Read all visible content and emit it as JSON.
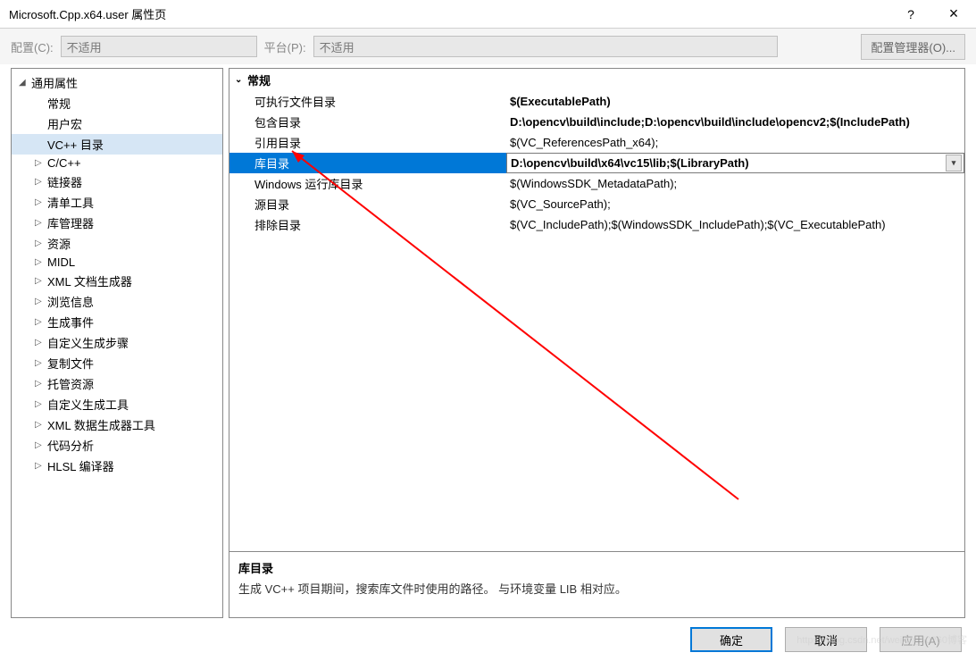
{
  "window": {
    "title": "Microsoft.Cpp.x64.user 属性页",
    "help": "?",
    "close": "×"
  },
  "toolbar": {
    "config_label": "配置(C):",
    "config_value": "不适用",
    "platform_label": "平台(P):",
    "platform_value": "不适用",
    "config_mgr": "配置管理器(O)..."
  },
  "tree": {
    "root": "通用属性",
    "items": [
      {
        "label": "常规",
        "level": 1,
        "expand": ""
      },
      {
        "label": "用户宏",
        "level": 1,
        "expand": ""
      },
      {
        "label": "VC++ 目录",
        "level": 1,
        "expand": "",
        "selected": true
      },
      {
        "label": "C/C++",
        "level": 1,
        "expand": "▷"
      },
      {
        "label": "链接器",
        "level": 1,
        "expand": "▷"
      },
      {
        "label": "清单工具",
        "level": 1,
        "expand": "▷"
      },
      {
        "label": "库管理器",
        "level": 1,
        "expand": "▷"
      },
      {
        "label": "资源",
        "level": 1,
        "expand": "▷"
      },
      {
        "label": "MIDL",
        "level": 1,
        "expand": "▷"
      },
      {
        "label": "XML 文档生成器",
        "level": 1,
        "expand": "▷"
      },
      {
        "label": "浏览信息",
        "level": 1,
        "expand": "▷"
      },
      {
        "label": "生成事件",
        "level": 1,
        "expand": "▷"
      },
      {
        "label": "自定义生成步骤",
        "level": 1,
        "expand": "▷"
      },
      {
        "label": "复制文件",
        "level": 1,
        "expand": "▷"
      },
      {
        "label": "托管资源",
        "level": 1,
        "expand": "▷"
      },
      {
        "label": "自定义生成工具",
        "level": 1,
        "expand": "▷"
      },
      {
        "label": "XML 数据生成器工具",
        "level": 1,
        "expand": "▷"
      },
      {
        "label": "代码分析",
        "level": 1,
        "expand": "▷"
      },
      {
        "label": "HLSL 编译器",
        "level": 1,
        "expand": "▷"
      }
    ]
  },
  "props": {
    "section": "常规",
    "rows": [
      {
        "label": "可执行文件目录",
        "value": "$(ExecutablePath)",
        "bold": true
      },
      {
        "label": "包含目录",
        "value": "D:\\opencv\\build\\include;D:\\opencv\\build\\include\\opencv2;$(IncludePath)",
        "bold": true
      },
      {
        "label": "引用目录",
        "value": "$(VC_ReferencesPath_x64);"
      },
      {
        "label": "库目录",
        "value": "D:\\opencv\\build\\x64\\vc15\\lib;$(LibraryPath)",
        "selected": true,
        "bold": true
      },
      {
        "label": "Windows 运行库目录",
        "value": "$(WindowsSDK_MetadataPath);"
      },
      {
        "label": "源目录",
        "value": "$(VC_SourcePath);"
      },
      {
        "label": "排除目录",
        "value": "$(VC_IncludePath);$(WindowsSDK_IncludePath);$(VC_ExecutablePath)"
      }
    ]
  },
  "desc": {
    "title": "库目录",
    "text": "生成 VC++ 项目期间，搜索库文件时使用的路径。 与环境变量 LIB 相对应。"
  },
  "buttons": {
    "ok": "确定",
    "cancel": "取消",
    "apply": "应用(A)"
  },
  "watermark": "https://blog.csdn.net/weixin_50260博客"
}
